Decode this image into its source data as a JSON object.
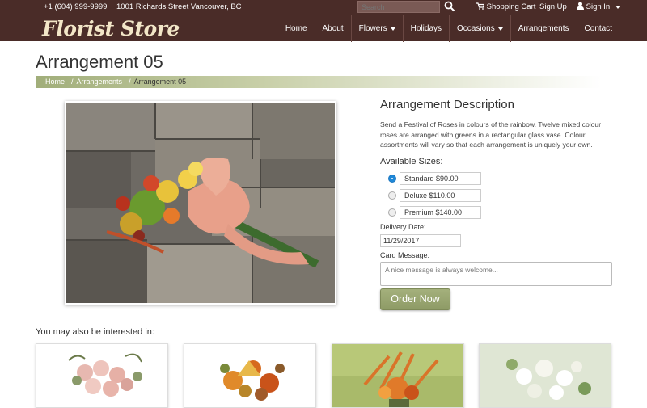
{
  "topbar": {
    "phone": "+1 (604) 999-9999",
    "address": "1001 Richards Street Vancouver, BC",
    "search_placeholder": "Search",
    "cart_label": "Shopping Cart",
    "signup_label": "Sign Up",
    "signin_label": "Sign In"
  },
  "nav": {
    "logo": "Florist Store",
    "items": [
      {
        "label": "Home"
      },
      {
        "label": "About"
      },
      {
        "label": "Flowers"
      },
      {
        "label": "Holidays"
      },
      {
        "label": "Occasions"
      },
      {
        "label": "Arrangements"
      },
      {
        "label": "Contact"
      }
    ]
  },
  "page": {
    "title": "Arrangement 05",
    "breadcrumb": [
      "Home",
      "Arrangements",
      "Arrangement 05"
    ]
  },
  "product": {
    "desc_title": "Arrangement Description",
    "description": "Send a Festival of Roses in colours of the rainbow. Twelve mixed colour roses are arranged with greens in a rectangular glass vase. Colour assortments will vary so that each arrangement is uniquely your own.",
    "sizes_title": "Available Sizes:",
    "sizes": [
      {
        "label": "Standard $90.00",
        "selected": true
      },
      {
        "label": "Deluxe $110.00",
        "selected": false
      },
      {
        "label": "Premium $140.00",
        "selected": false
      }
    ],
    "delivery_label": "Delivery Date:",
    "delivery_value": "11/29/2017",
    "card_label": "Card Message:",
    "card_placeholder": "A nice message is always welcome...",
    "order_label": "Order Now"
  },
  "related": {
    "title": "You may also be interested in:"
  },
  "colors": {
    "header_bg": "#4a2c28",
    "accent_green": "#9aa672",
    "logo_color": "#f3e7c8"
  }
}
